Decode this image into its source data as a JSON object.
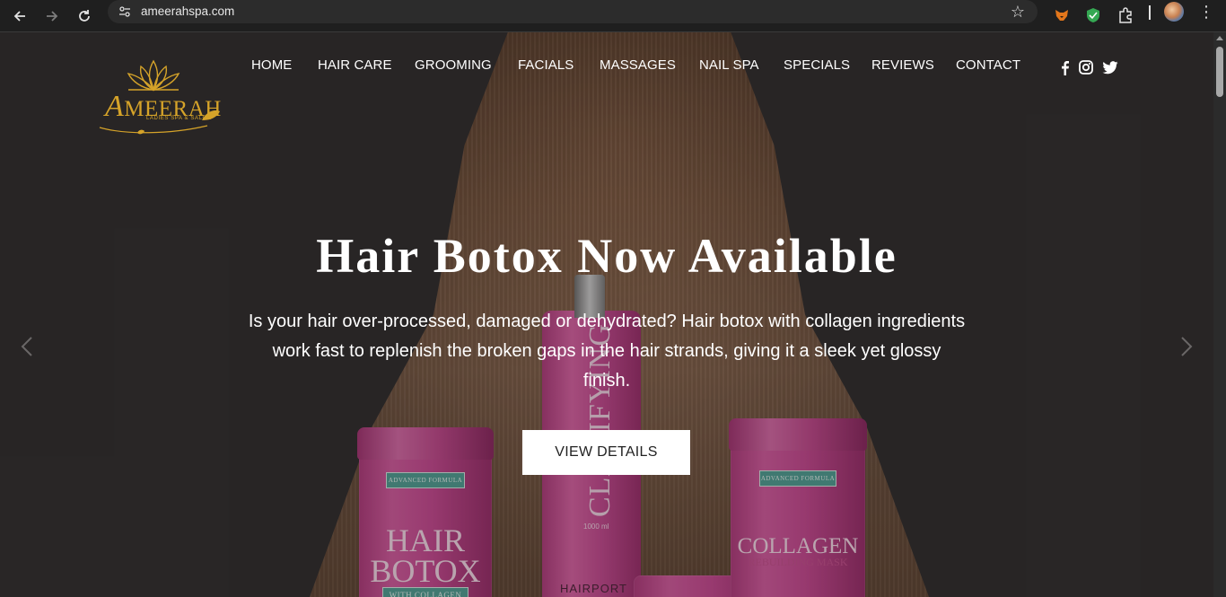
{
  "browser": {
    "url": "ameerahspa.com",
    "back_icon": "arrow-left-icon",
    "forward_icon": "arrow-right-icon",
    "reload_icon": "reload-icon",
    "bookmark_icon": "star-icon",
    "extension_icons": [
      "fox-extension-icon",
      "shield-extension-icon",
      "puzzle-extensions-icon"
    ]
  },
  "site": {
    "logo_text": "MEERAH",
    "logo_initial": "A",
    "logo_tagline": "LADIES SPA & SALON",
    "nav": [
      "HOME",
      "HAIR CARE",
      "GROOMING",
      "FACIALS",
      "MASSAGES",
      "NAIL SPA",
      "SPECIALS",
      "REVIEWS",
      "CONTACT"
    ],
    "social": [
      "facebook-icon",
      "instagram-icon",
      "twitter-icon"
    ],
    "accent_color": "#d5a329"
  },
  "hero": {
    "title": "Hair Botox Now Available",
    "text": "Is your hair over-processed, damaged or dehydrated? Hair botox with collagen ingredients work fast to replenish the broken gaps in the hair strands, giving it a sleek yet glossy finish.",
    "cta": "VIEW DETAILS",
    "prev_icon": "chevron-left-icon",
    "next_icon": "chevron-right-icon"
  },
  "products": {
    "jar1_tag": "ADVANCED FORMULA",
    "jar1_line1": "HAIR",
    "jar1_line2": "BOTOX",
    "jar1_sub": "WITH COLLAGEN",
    "bottle_text": "CLARIFYING",
    "bottle_ml": "1000 ml",
    "bottle_brand": "HAIRPORT",
    "jar2_tag": "ADVANCED FORMULA",
    "jar2_line1": "COLLAGEN",
    "jar2_sub": "REBUILDING MASK"
  }
}
